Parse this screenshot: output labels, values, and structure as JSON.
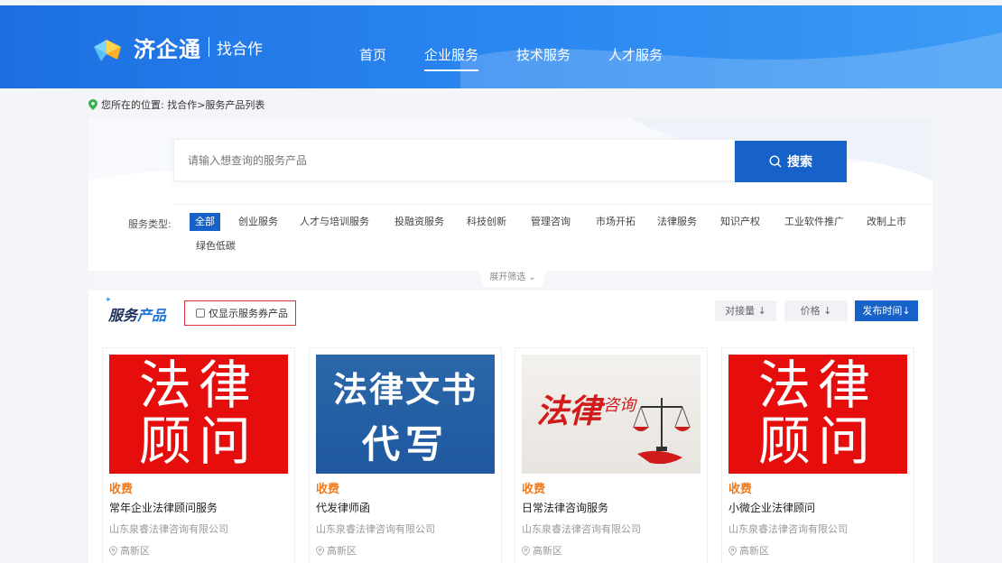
{
  "brand": {
    "name": "济企通",
    "sub": "找合作"
  },
  "nav": [
    {
      "label": "首页",
      "active": false
    },
    {
      "label": "企业服务",
      "active": true
    },
    {
      "label": "技术服务",
      "active": false
    },
    {
      "label": "人才服务",
      "active": false
    }
  ],
  "breadcrumb": "您所在的位置: 找合作>服务产品列表",
  "search": {
    "placeholder": "请输入想查询的服务产品",
    "button": "搜索"
  },
  "filter": {
    "label": "服务类型:",
    "items": [
      "全部",
      "创业服务",
      "人才与培训服务",
      "投融资服务",
      "科技创新",
      "管理咨询",
      "市场开拓",
      "法律服务",
      "知识产权",
      "工业软件推广",
      "改制上市",
      "绿色低碳"
    ],
    "selected": "全部"
  },
  "expand_label": "展开筛选 ⌄",
  "products": {
    "title_dark": "服务",
    "title_accent": "产品",
    "coupon_only_label": "仅显示服务券产品",
    "coupon_only_checked": false,
    "sort": [
      {
        "label": "对接量 ↓",
        "active": false
      },
      {
        "label": "价格 ↓",
        "active": false
      },
      {
        "label": "发布时间↓",
        "active": true
      }
    ]
  },
  "cards": [
    {
      "image_text": [
        "法律",
        "顾问"
      ],
      "fee": "收费",
      "name": "常年企业法律顾问服务",
      "company": "山东泉睿法律咨询有限公司",
      "location": "高新区"
    },
    {
      "image_text": [
        "法律文书",
        "代写"
      ],
      "fee": "收费",
      "name": "代发律师函",
      "company": "山东泉睿法律咨询有限公司",
      "location": "高新区"
    },
    {
      "image_text": [
        "法律",
        "咨询"
      ],
      "fee": "收费",
      "name": "日常法律咨询服务",
      "company": "山东泉睿法律咨询有限公司",
      "location": "高新区"
    },
    {
      "image_text": [
        "法律",
        "顾问"
      ],
      "fee": "收费",
      "name": "小微企业法律顾问",
      "company": "山东泉睿法律咨询有限公司",
      "location": "高新区"
    }
  ],
  "colors": {
    "primary": "#1662c8",
    "header": "#2a86f0",
    "fee": "#f07b1e",
    "image_red": "#e60d0d",
    "coupon_border": "#d9353b"
  }
}
